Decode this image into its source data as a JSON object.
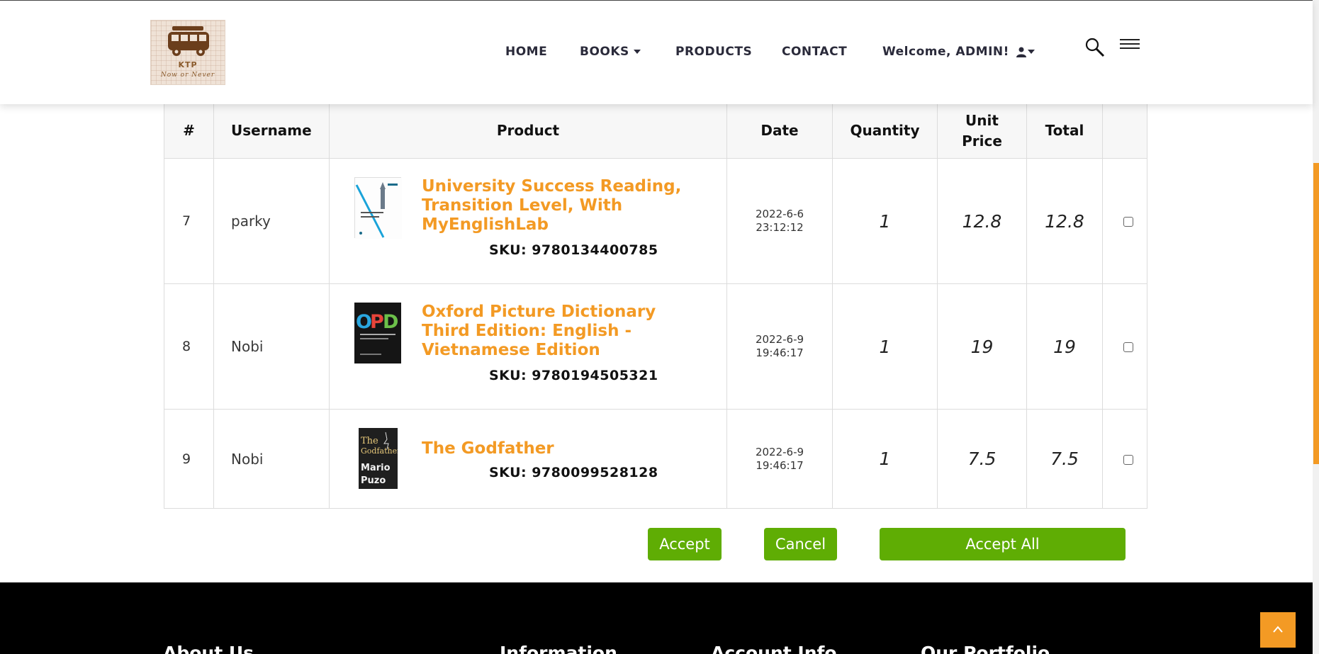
{
  "brand": {
    "name": "KTP",
    "tagline": "Now or Never"
  },
  "nav": {
    "home": "HOME",
    "books": "BOOKS",
    "products": "PRODUCTS",
    "contact": "CONTACT",
    "welcome": "Welcome, ADMIN!"
  },
  "table": {
    "headers": {
      "num": "#",
      "username": "Username",
      "product": "Product",
      "date": "Date",
      "quantity": "Quantity",
      "unit_price_1": "Unit",
      "unit_price_2": "Price",
      "total": "Total"
    },
    "rows": [
      {
        "num": "7",
        "username": "parky",
        "title": "University Success Reading, Transition Level, With MyEnglishLab",
        "sku": "SKU: 9780134400785",
        "date1": "2022-6-6",
        "date2": "23:12:12",
        "quantity": "1",
        "unit_price": "12.8",
        "total": "12.8"
      },
      {
        "num": "8",
        "username": "Nobi",
        "title": "Oxford Picture Dictionary Third Edition: English - Vietnamese Edition",
        "sku": "SKU: 9780194505321",
        "date1": "2022-6-9",
        "date2": "19:46:17",
        "quantity": "1",
        "unit_price": "19",
        "total": "19"
      },
      {
        "num": "9",
        "username": "Nobi",
        "title": "The Godfather",
        "sku": "SKU: 9780099528128",
        "date1": "2022-6-9",
        "date2": "19:46:17",
        "quantity": "1",
        "unit_price": "7.5",
        "total": "7.5"
      }
    ]
  },
  "actions": {
    "accept": "Accept",
    "cancel": "Cancel",
    "accept_all": "Accept All"
  },
  "footer": {
    "about": "About Us",
    "information": "Information",
    "account": "Account Info",
    "portfolio": "Our Portfolio"
  },
  "colors": {
    "accent": "#f39a24",
    "button": "#5fad04",
    "footer_bg": "#000000"
  },
  "icons": [
    "user-icon",
    "search-icon",
    "menu-icon",
    "arrow-up-icon",
    "chevron-down-icon"
  ]
}
